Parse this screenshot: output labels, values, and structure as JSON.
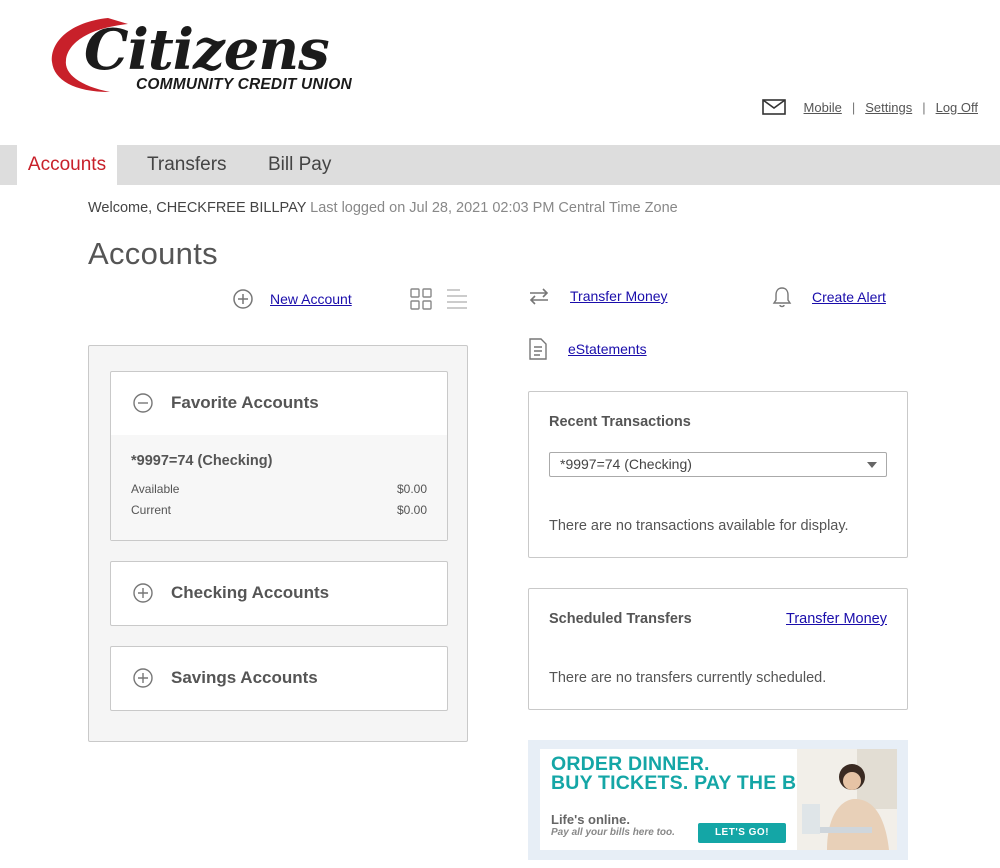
{
  "brand": {
    "name": "Citizens",
    "subtitle": "COMMUNITY CREDIT UNION",
    "colors": {
      "accent_red": "#c8202a",
      "teal": "#14a6a6"
    }
  },
  "top_links": {
    "mail_icon": "mail-icon",
    "mobile": "Mobile",
    "settings": "Settings",
    "logoff": "Log Off"
  },
  "nav": {
    "tabs": [
      {
        "label": "Accounts",
        "active": true
      },
      {
        "label": "Transfers",
        "active": false
      },
      {
        "label": "Bill Pay",
        "active": false
      }
    ]
  },
  "welcome": {
    "greeting": "Welcome, CHECKFREE BILLPAY",
    "last_login": "Last logged on Jul 28, 2021 02:03 PM Central Time Zone"
  },
  "page_title": "Accounts",
  "toolbar": {
    "new_account": "New Account",
    "transfer_money": "Transfer Money",
    "create_alert": "Create Alert",
    "estatements": "eStatements"
  },
  "account_groups": {
    "favorite": {
      "title": "Favorite Accounts",
      "account": {
        "name": "*9997=74 (Checking)",
        "available_label": "Available",
        "available_value": "$0.00",
        "current_label": "Current",
        "current_value": "$0.00"
      }
    },
    "checking": {
      "title": "Checking Accounts"
    },
    "savings": {
      "title": "Savings Accounts"
    }
  },
  "recent_transactions": {
    "title": "Recent Transactions",
    "selected_account": "*9997=74 (Checking)",
    "empty_message": "There are no transactions available for display."
  },
  "scheduled_transfers": {
    "title": "Scheduled Transfers",
    "link": "Transfer Money",
    "empty_message": "There are no transfers currently scheduled."
  },
  "ad": {
    "headline_1": "ORDER DINNER.",
    "headline_2": "BUY TICKETS. PAY THE BILLS.",
    "tagline": "Life's online.",
    "subtext": "Pay all your bills here too.",
    "button": "LET'S GO!"
  }
}
